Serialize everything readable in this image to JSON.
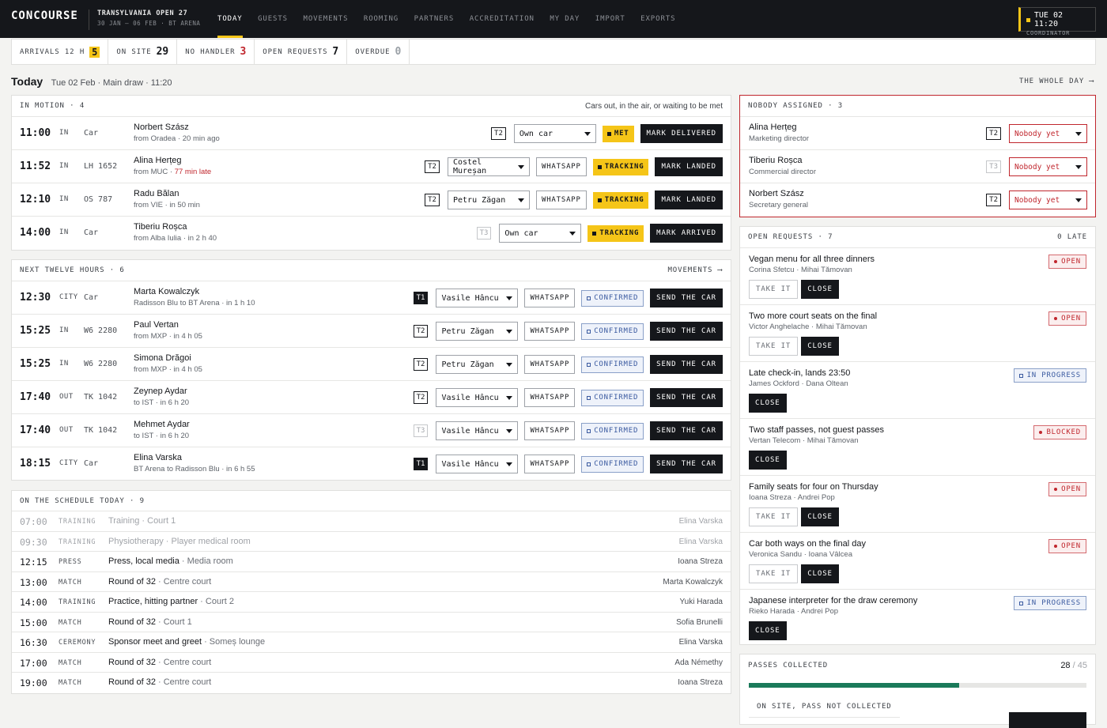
{
  "app": {
    "brand": "CONCOURSE",
    "event_name": "TRANSYLVANIA OPEN 27",
    "event_dates": "30 JAN – 06 FEB · BT ARENA"
  },
  "nav": [
    {
      "label": "TODAY",
      "active": true
    },
    {
      "label": "GUESTS"
    },
    {
      "label": "MOVEMENTS"
    },
    {
      "label": "ROOMING"
    },
    {
      "label": "PARTNERS"
    },
    {
      "label": "ACCREDITATION"
    },
    {
      "label": "MY DAY"
    },
    {
      "label": "IMPORT"
    },
    {
      "label": "EXPORTS"
    }
  ],
  "clock": {
    "time": "TUE 02 11:20",
    "role": "COORDINATOR"
  },
  "stats": [
    {
      "label": "ARRIVALS 12 H",
      "value": "5",
      "style": "hl"
    },
    {
      "label": "ON SITE",
      "value": "29",
      "style": ""
    },
    {
      "label": "NO HANDLER",
      "value": "3",
      "style": "red"
    },
    {
      "label": "OPEN REQUESTS",
      "value": "7",
      "style": ""
    },
    {
      "label": "OVERDUE",
      "value": "0",
      "style": "grey"
    }
  ],
  "heading": {
    "title": "Today",
    "sub": "Tue 02 Feb · Main draw · 11:20",
    "whole_day": "THE WHOLE DAY ⟶"
  },
  "in_motion": {
    "title": "IN MOTION · 4",
    "note": "Cars out, in the air, or waiting to be met",
    "rows": [
      {
        "time": "11:00",
        "dir": "IN",
        "mode": "Car",
        "name": "Norbert Szász",
        "sub": "from Oradea · 20 min ago",
        "late": "",
        "term": "T2",
        "term_style": "",
        "select": "Own car",
        "sel_w": 104,
        "whatsapp": "",
        "badge": "MET",
        "badge_style": "y",
        "action": "MARK DELIVERED"
      },
      {
        "time": "11:52",
        "dir": "IN",
        "mode": "LH 1652",
        "name": "Alina Herțeg",
        "sub": "from MUC · ",
        "late": "77 min late",
        "term": "T2",
        "term_style": "",
        "select": "Costel Mureșan",
        "sel_w": 104,
        "whatsapp": "WHATSAPP",
        "badge": "TRACKING",
        "badge_style": "y",
        "action": "MARK LANDED"
      },
      {
        "time": "12:10",
        "dir": "IN",
        "mode": "OS 787",
        "name": "Radu Bălan",
        "sub": "from VIE · in 50 min",
        "late": "",
        "term": "T2",
        "term_style": "",
        "select": "Petru Zăgan",
        "sel_w": 104,
        "whatsapp": "WHATSAPP",
        "badge": "TRACKING",
        "badge_style": "y",
        "action": "MARK LANDED"
      },
      {
        "time": "14:00",
        "dir": "IN",
        "mode": "Car",
        "name": "Tiberiu Roșca",
        "sub": "from Alba Iulia · in 2 h 40",
        "late": "",
        "term": "T3",
        "term_style": "dim",
        "select": "Own car",
        "sel_w": 104,
        "whatsapp": "",
        "badge": "TRACKING",
        "badge_style": "y",
        "action": "MARK ARRIVED"
      }
    ]
  },
  "next_twelve": {
    "title": "NEXT TWELVE HOURS · 6",
    "link": "MOVEMENTS ⟶",
    "rows": [
      {
        "time": "12:30",
        "dir": "CITY",
        "mode": "Car",
        "name": "Marta Kowalczyk",
        "sub": "Radisson Blu to BT Arena · in 1 h 10",
        "late": "",
        "term": "T1",
        "term_style": "solid",
        "select": "Vasile Hâncu",
        "sel_w": 104,
        "whatsapp": "WHATSAPP",
        "badge": "CONFIRMED",
        "badge_style": "c",
        "action": "SEND THE CAR"
      },
      {
        "time": "15:25",
        "dir": "IN",
        "mode": "W6 2280",
        "name": "Paul Vertan",
        "sub": "from MXP · in 4 h 05",
        "late": "",
        "term": "T2",
        "term_style": "",
        "select": "Petru Zăgan",
        "sel_w": 104,
        "whatsapp": "WHATSAPP",
        "badge": "CONFIRMED",
        "badge_style": "c",
        "action": "SEND THE CAR"
      },
      {
        "time": "15:25",
        "dir": "IN",
        "mode": "W6 2280",
        "name": "Simona Drăgoi",
        "sub": "from MXP · in 4 h 05",
        "late": "",
        "term": "T2",
        "term_style": "",
        "select": "Petru Zăgan",
        "sel_w": 104,
        "whatsapp": "WHATSAPP",
        "badge": "CONFIRMED",
        "badge_style": "c",
        "action": "SEND THE CAR"
      },
      {
        "time": "17:40",
        "dir": "OUT",
        "mode": "TK 1042",
        "name": "Zeynep Aydar",
        "sub": "to IST · in 6 h 20",
        "late": "",
        "term": "T2",
        "term_style": "",
        "select": "Vasile Hâncu",
        "sel_w": 104,
        "whatsapp": "WHATSAPP",
        "badge": "CONFIRMED",
        "badge_style": "c",
        "action": "SEND THE CAR"
      },
      {
        "time": "17:40",
        "dir": "OUT",
        "mode": "TK 1042",
        "name": "Mehmet Aydar",
        "sub": "to IST · in 6 h 20",
        "late": "",
        "term": "T3",
        "term_style": "dim",
        "select": "Vasile Hâncu",
        "sel_w": 104,
        "whatsapp": "WHATSAPP",
        "badge": "CONFIRMED",
        "badge_style": "c",
        "action": "SEND THE CAR"
      },
      {
        "time": "18:15",
        "dir": "CITY",
        "mode": "Car",
        "name": "Elina Varska",
        "sub": "BT Arena to Radisson Blu · in 6 h 55",
        "late": "",
        "term": "T1",
        "term_style": "solid",
        "select": "Vasile Hâncu",
        "sel_w": 104,
        "whatsapp": "WHATSAPP",
        "badge": "CONFIRMED",
        "badge_style": "c",
        "action": "SEND THE CAR"
      }
    ]
  },
  "schedule": {
    "title": "ON THE SCHEDULE TODAY · 9",
    "rows": [
      {
        "time": "07:00",
        "type": "TRAINING",
        "title": "Training",
        "place": " · Court 1",
        "person": "Elina Varska",
        "past": true
      },
      {
        "time": "09:30",
        "type": "TRAINING",
        "title": "Physiotherapy",
        "place": " · Player medical room",
        "person": "Elina Varska",
        "past": true
      },
      {
        "time": "12:15",
        "type": "PRESS",
        "title": "Press, local media",
        "place": " · Media room",
        "person": "Ioana Streza",
        "past": false
      },
      {
        "time": "13:00",
        "type": "MATCH",
        "title": "Round of 32",
        "place": " · Centre court",
        "person": "Marta Kowalczyk",
        "past": false
      },
      {
        "time": "14:00",
        "type": "TRAINING",
        "title": "Practice, hitting partner",
        "place": " · Court 2",
        "person": "Yuki Harada",
        "past": false
      },
      {
        "time": "15:00",
        "type": "MATCH",
        "title": "Round of 32",
        "place": " · Court 1",
        "person": "Sofia Brunelli",
        "past": false
      },
      {
        "time": "16:30",
        "type": "CEREMONY",
        "title": "Sponsor meet and greet",
        "place": " · Someș lounge",
        "person": "Elina Varska",
        "past": false
      },
      {
        "time": "17:00",
        "type": "MATCH",
        "title": "Round of 32",
        "place": " · Centre court",
        "person": "Ada Némethy",
        "past": false
      },
      {
        "time": "19:00",
        "type": "MATCH",
        "title": "Round of 32",
        "place": " · Centre court",
        "person": "Ioana Streza",
        "past": false
      }
    ]
  },
  "nobody": {
    "title": "NOBODY ASSIGNED · 3",
    "rows": [
      {
        "name": "Alina Herțeg",
        "role": "Marketing director",
        "term": "T2",
        "term_style": "",
        "select": "Nobody yet"
      },
      {
        "name": "Tiberiu Roșca",
        "role": "Commercial director",
        "term": "T3",
        "term_style": "dim",
        "select": "Nobody yet"
      },
      {
        "name": "Norbert Szász",
        "role": "Secretary general",
        "term": "T2",
        "term_style": "",
        "select": "Nobody yet"
      }
    ]
  },
  "requests": {
    "title": "OPEN REQUESTS · 7",
    "late": "0 LATE",
    "take": "TAKE IT",
    "close": "CLOSE",
    "rows": [
      {
        "title": "Vegan menu for all three dinners",
        "who": "Corina Sfetcu · Mihai Tămovan",
        "status": "OPEN",
        "status_style": "open",
        "take": true
      },
      {
        "title": "Two more court seats on the final",
        "who": "Victor Anghelache · Mihai Tămovan",
        "status": "OPEN",
        "status_style": "open",
        "take": true
      },
      {
        "title": "Late check-in, lands 23:50",
        "who": "James Ockford · Dana Oltean",
        "status": "IN PROGRESS",
        "status_style": "prog",
        "take": false
      },
      {
        "title": "Two staff passes, not guest passes",
        "who": "Vertan Telecom · Mihai Tămovan",
        "status": "BLOCKED",
        "status_style": "blocked",
        "take": false
      },
      {
        "title": "Family seats for four on Thursday",
        "who": "Ioana Streza · Andrei Pop",
        "status": "OPEN",
        "status_style": "open",
        "take": true
      },
      {
        "title": "Car both ways on the final day",
        "who": "Veronica Sandu · Ioana Vâlcea",
        "status": "OPEN",
        "status_style": "open",
        "take": true
      },
      {
        "title": "Japanese interpreter for the draw ceremony",
        "who": "Rieko Harada · Andrei Pop",
        "status": "IN PROGRESS",
        "status_style": "prog",
        "take": false
      }
    ]
  },
  "passes": {
    "title": "PASSES COLLECTED",
    "collected": "28",
    "total": "45",
    "sep": "/",
    "fraction": 0.622,
    "sub": "ON SITE, PASS NOT COLLECTED"
  },
  "colors": {
    "accent": "#f5c518",
    "dark": "#15171b",
    "alert": "#c0262d",
    "progress": "#1a7a5a",
    "confirmed": "#3a5aa0"
  }
}
